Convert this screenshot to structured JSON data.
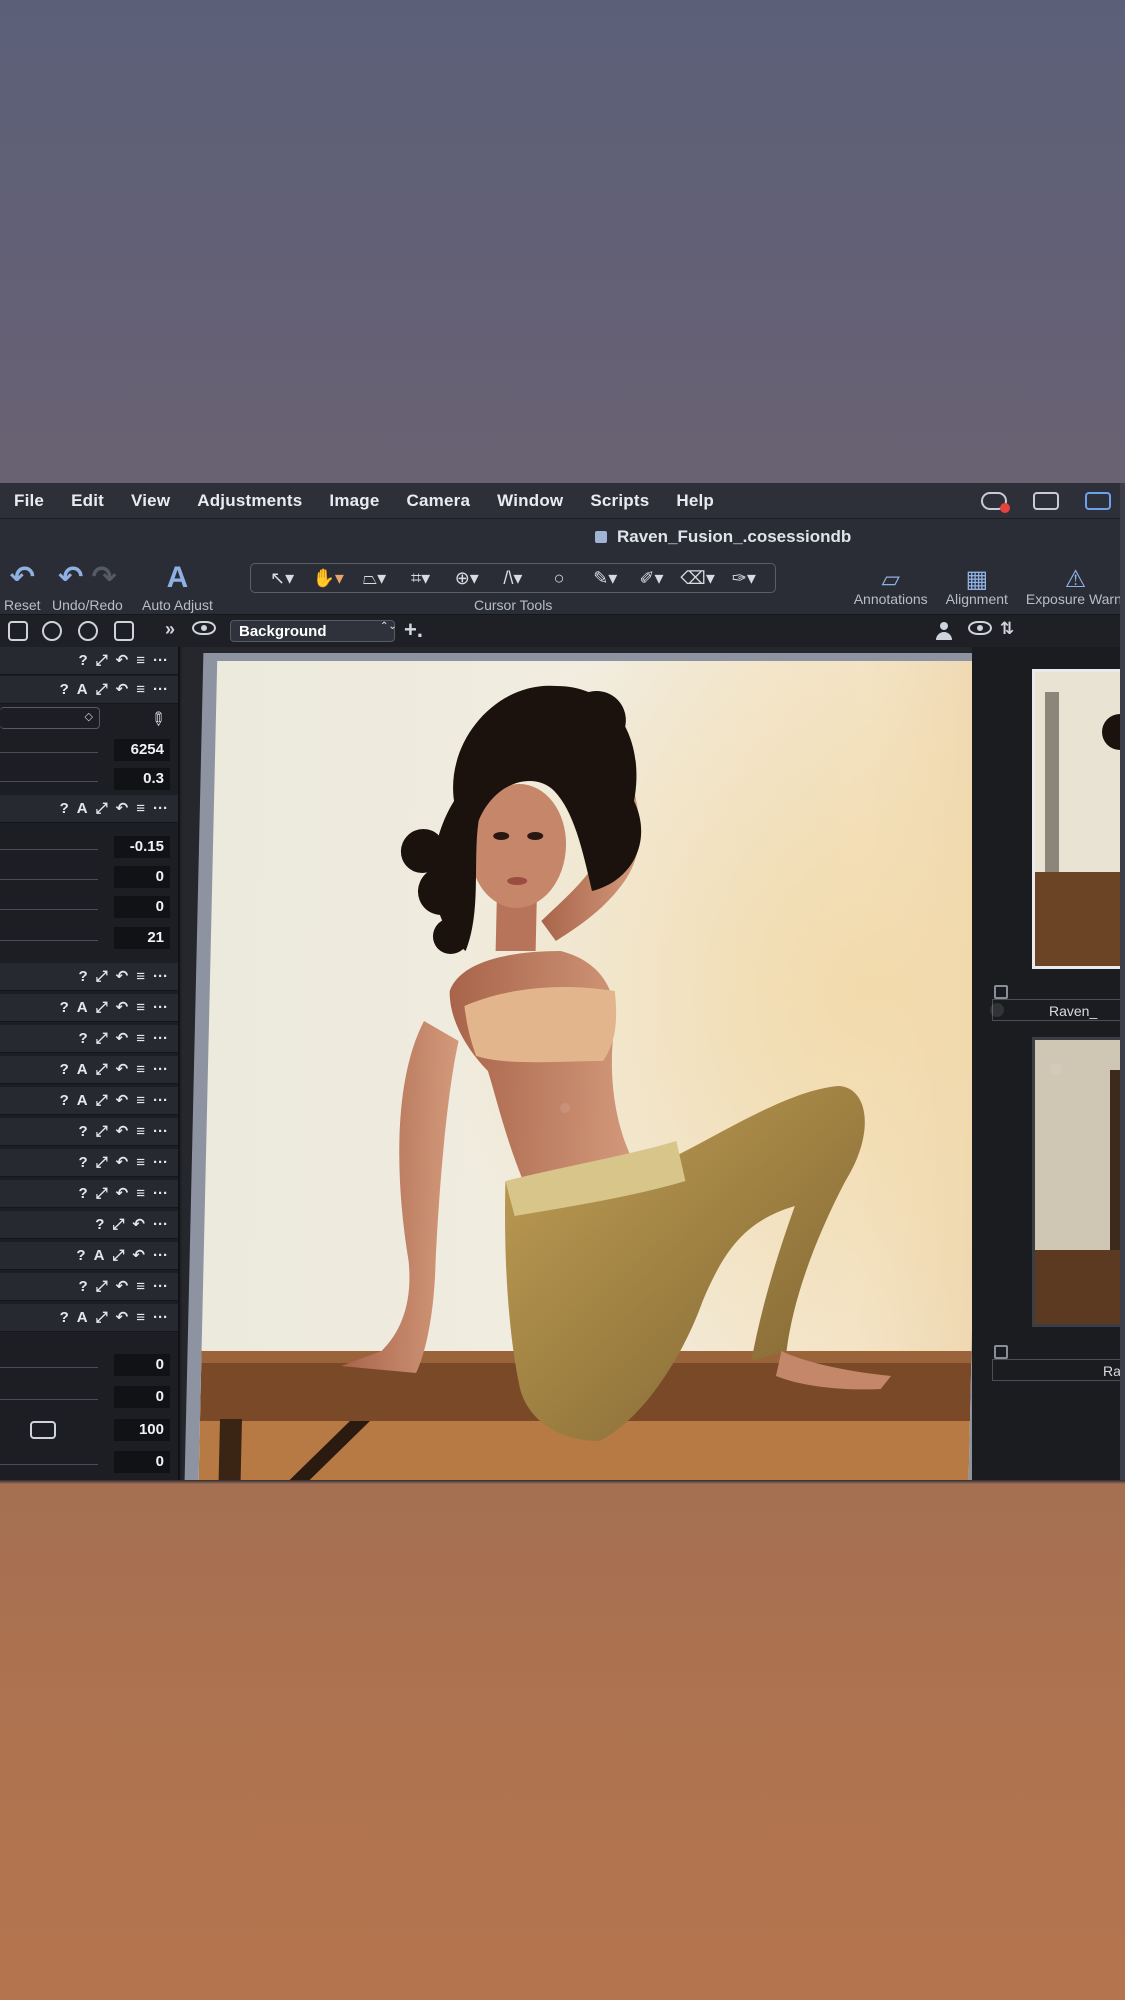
{
  "menu": [
    "File",
    "Edit",
    "View",
    "Adjustments",
    "Image",
    "Camera",
    "Window",
    "Scripts",
    "Help"
  ],
  "document_title": "Raven_Fusion_.cosessiondb",
  "toolbar": {
    "reset_label": "Reset",
    "undo_redo_label": "Undo/Redo",
    "auto_adjust_label": "Auto Adjust",
    "cursor_tools_label": "Cursor Tools",
    "annotations_label": "Annotations",
    "alignment_label": "Alignment",
    "exposure_label": "Exposure Warni"
  },
  "layer": {
    "selected": "Background"
  },
  "sliders": {
    "white_balance_kelvin": "6254",
    "white_balance_tint": "0.3",
    "exposure_1": "-0.15",
    "exposure_2": "0",
    "exposure_3": "0",
    "exposure_4": "21",
    "bottom_1": "0",
    "bottom_2": "0",
    "bottom_3": "100",
    "bottom_4": "0"
  },
  "tool_icons": {
    "help": "?",
    "auto": "A",
    "more": "···"
  },
  "thumbnails": [
    {
      "label": "Raven_"
    },
    {
      "label": "Ra"
    }
  ]
}
